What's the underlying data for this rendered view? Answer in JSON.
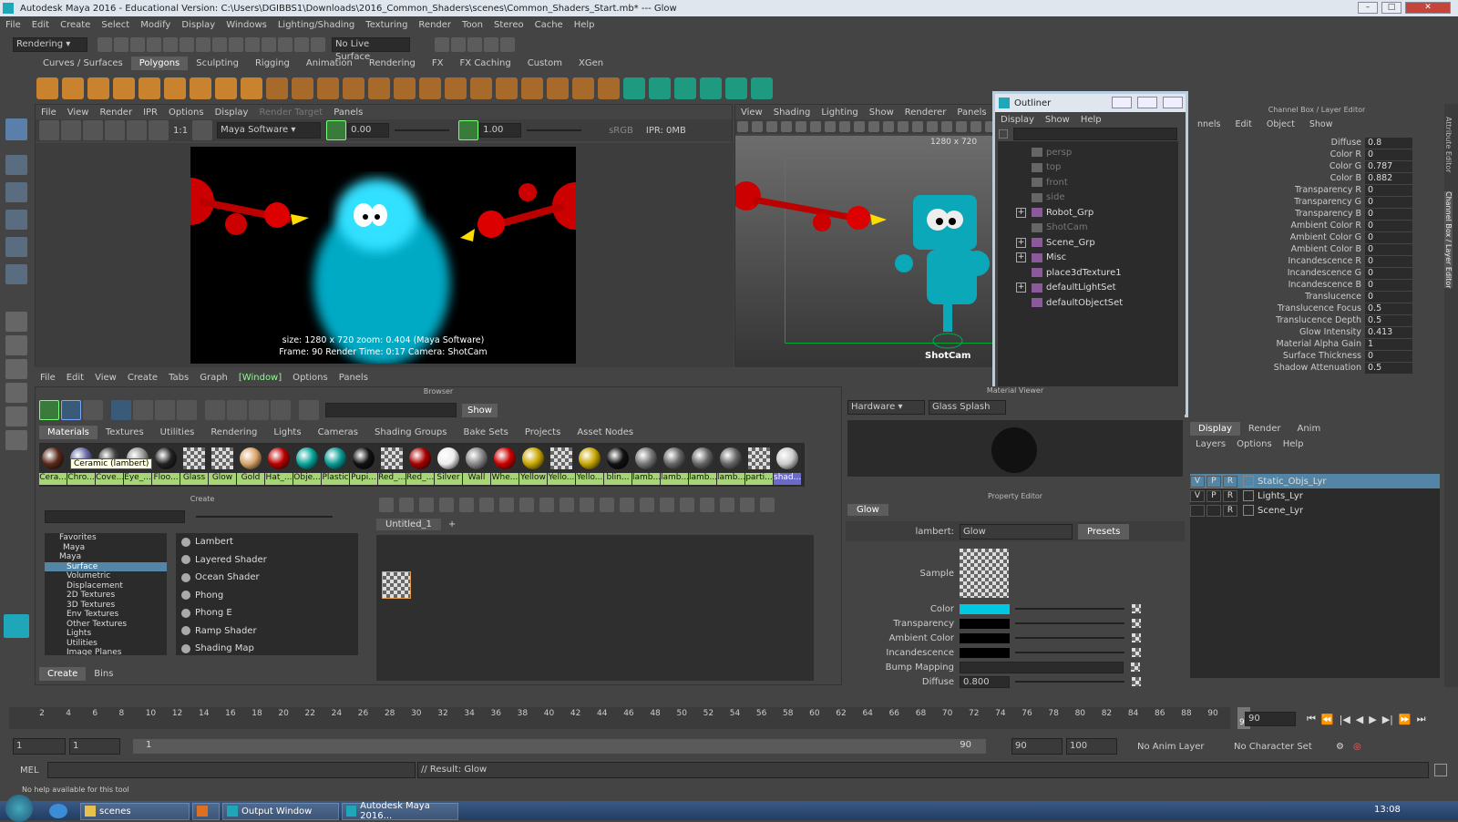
{
  "title": "Autodesk Maya 2016 - Educational Version: C:\\Users\\DGIBBS1\\Downloads\\2016_Common_Shaders\\scenes\\Common_Shaders_Start.mb*  ---  Glow",
  "menu": [
    "File",
    "Edit",
    "Create",
    "Select",
    "Modify",
    "Display",
    "Windows",
    "Lighting/Shading",
    "Texturing",
    "Render",
    "Toon",
    "Stereo",
    "Cache",
    "Help"
  ],
  "menuset": "Rendering",
  "live_surface": "No Live Surface",
  "shelf_tabs": [
    "Curves / Surfaces",
    "Polygons",
    "Sculpting",
    "Rigging",
    "Animation",
    "Rendering",
    "FX",
    "FX Caching",
    "Custom",
    "XGen"
  ],
  "render_view": {
    "menu": [
      "File",
      "View",
      "Render",
      "IPR",
      "Options",
      "Display",
      "Render Target",
      "Panels"
    ],
    "renderer": "Maya Software",
    "exposure": "0.00",
    "gamma": "1.00",
    "srgb": "sRGB",
    "ipr": "IPR: 0MB",
    "ratio": "1:1",
    "info1": "size: 1280 x 720  zoom: 0.404       (Maya Software)",
    "info2": "Frame: 90      Render Time: 0:17        Camera: ShotCam"
  },
  "viewport": {
    "menu": [
      "View",
      "Shading",
      "Lighting",
      "Show",
      "Renderer",
      "Panels"
    ],
    "res": "1280 x 720",
    "camera": "ShotCam"
  },
  "outliner": {
    "title": "Outliner",
    "menu": [
      "Display",
      "Show",
      "Help"
    ],
    "items": [
      {
        "label": "persp",
        "dim": true,
        "plus": false
      },
      {
        "label": "top",
        "dim": true,
        "plus": false
      },
      {
        "label": "front",
        "dim": true,
        "plus": false
      },
      {
        "label": "side",
        "dim": true,
        "plus": false
      },
      {
        "label": "Robot_Grp",
        "dim": false,
        "plus": true
      },
      {
        "label": "ShotCam",
        "dim": true,
        "plus": false
      },
      {
        "label": "Scene_Grp",
        "dim": false,
        "plus": true
      },
      {
        "label": "Misc",
        "dim": false,
        "plus": true
      },
      {
        "label": "place3dTexture1",
        "dim": false,
        "plus": false
      },
      {
        "label": "defaultLightSet",
        "dim": false,
        "plus": true
      },
      {
        "label": "defaultObjectSet",
        "dim": false,
        "plus": false
      }
    ]
  },
  "channel_box": {
    "title": "Channel Box / Layer Editor",
    "menu": [
      "nnels",
      "Edit",
      "Object",
      "Show"
    ],
    "attrs": [
      {
        "n": "Diffuse",
        "v": "0.8"
      },
      {
        "n": "Color R",
        "v": "0"
      },
      {
        "n": "Color G",
        "v": "0.787"
      },
      {
        "n": "Color B",
        "v": "0.882"
      },
      {
        "n": "Transparency R",
        "v": "0"
      },
      {
        "n": "Transparency G",
        "v": "0"
      },
      {
        "n": "Transparency B",
        "v": "0"
      },
      {
        "n": "Ambient Color R",
        "v": "0"
      },
      {
        "n": "Ambient Color G",
        "v": "0"
      },
      {
        "n": "Ambient Color B",
        "v": "0"
      },
      {
        "n": "Incandescence R",
        "v": "0"
      },
      {
        "n": "Incandescence G",
        "v": "0"
      },
      {
        "n": "Incandescence B",
        "v": "0"
      },
      {
        "n": "Translucence",
        "v": "0"
      },
      {
        "n": "Translucence Focus",
        "v": "0.5"
      },
      {
        "n": "Translucence Depth",
        "v": "0.5"
      },
      {
        "n": "Glow Intensity",
        "v": "0.413"
      },
      {
        "n": "Material Alpha Gain",
        "v": "1"
      },
      {
        "n": "Surface Thickness",
        "v": "0"
      },
      {
        "n": "Shadow Attenuation",
        "v": "0.5"
      }
    ]
  },
  "side_tabs": [
    "Attribute Editor",
    "Channel Box / Layer Editor"
  ],
  "hypershade": {
    "menu": [
      "File",
      "Edit",
      "View",
      "Create",
      "Tabs",
      "Graph",
      "[Window]",
      "Options",
      "Panels"
    ],
    "browser_title": "Browser",
    "show": "Show",
    "browser_tabs": [
      "Materials",
      "Textures",
      "Utilities",
      "Rendering",
      "Lights",
      "Cameras",
      "Shading Groups",
      "Bake Sets",
      "Projects",
      "Asset Nodes"
    ],
    "tooltip": "Ceramic (lambert)",
    "swatches": [
      {
        "l": "Cera...",
        "c": "#5a2a1a"
      },
      {
        "l": "Chro...",
        "c": "#6a6aa8"
      },
      {
        "l": "Cove...",
        "c": "#444"
      },
      {
        "l": "Eye_...",
        "c": "#999"
      },
      {
        "l": "Floo...",
        "c": "#222"
      },
      {
        "l": "Glass",
        "c": "chk"
      },
      {
        "l": "Glow",
        "c": "chk"
      },
      {
        "l": "Gold",
        "c": "#d9a56a"
      },
      {
        "l": "Hat_...",
        "c": "#b00"
      },
      {
        "l": "Obje...",
        "c": "#0aa59a"
      },
      {
        "l": "Plastic",
        "c": "#0a9a95"
      },
      {
        "l": "Pupi...",
        "c": "#111"
      },
      {
        "l": "Red_...",
        "c": "chk"
      },
      {
        "l": "Red_...",
        "c": "#a00"
      },
      {
        "l": "Silver",
        "c": "#eee"
      },
      {
        "l": "Wall",
        "c": "#888"
      },
      {
        "l": "Whe...",
        "c": "#c00"
      },
      {
        "l": "Yellow",
        "c": "#c9a800"
      },
      {
        "l": "Yello...",
        "c": "chk"
      },
      {
        "l": "Yello...",
        "c": "#c9a800"
      },
      {
        "l": "blin...",
        "c": "#111"
      },
      {
        "l": "lamb...",
        "c": "#777"
      },
      {
        "l": "lamb...",
        "c": "#666"
      },
      {
        "l": "lamb...",
        "c": "#666"
      },
      {
        "l": "lamb...",
        "c": "#666"
      },
      {
        "l": "parti...",
        "c": "chk"
      },
      {
        "l": "shad...",
        "c": "#ccc"
      }
    ],
    "create_title": "Create",
    "tree": [
      {
        "l": "Favorites",
        "sel": false,
        "ind": 0
      },
      {
        "l": "Maya",
        "sel": false,
        "ind": 1
      },
      {
        "l": "Maya",
        "sel": false,
        "ind": 0
      },
      {
        "l": "Surface",
        "sel": true,
        "ind": 2
      },
      {
        "l": "Volumetric",
        "sel": false,
        "ind": 2
      },
      {
        "l": "Displacement",
        "sel": false,
        "ind": 2
      },
      {
        "l": "2D Textures",
        "sel": false,
        "ind": 2
      },
      {
        "l": "3D Textures",
        "sel": false,
        "ind": 2
      },
      {
        "l": "Env Textures",
        "sel": false,
        "ind": 2
      },
      {
        "l": "Other Textures",
        "sel": false,
        "ind": 2
      },
      {
        "l": "Lights",
        "sel": false,
        "ind": 2
      },
      {
        "l": "Utilities",
        "sel": false,
        "ind": 2
      },
      {
        "l": "Image Planes",
        "sel": false,
        "ind": 2
      }
    ],
    "create_items": [
      "Lambert",
      "Layered Shader",
      "Ocean Shader",
      "Phong",
      "Phong E",
      "Ramp Shader",
      "Shading Map"
    ],
    "bottom_tabs": [
      "Create",
      "Bins"
    ],
    "graph_tab": "Untitled_1",
    "graph_plus": "+"
  },
  "material_viewer": {
    "title": "Material Viewer",
    "renderer": "Hardware",
    "env": "Glass Splash"
  },
  "property_editor": {
    "title": "Property Editor",
    "tab": "Glow",
    "type_label": "lambert:",
    "name": "Glow",
    "presets": "Presets",
    "sample": "Sample",
    "rows": [
      "Color",
      "Transparency",
      "Ambient Color",
      "Incandescence",
      "Bump Mapping",
      "Diffuse"
    ],
    "diffuse_val": "0.800"
  },
  "layers": {
    "tabs": [
      "Display",
      "Render",
      "Anim"
    ],
    "menu": [
      "Layers",
      "Options",
      "Help"
    ],
    "rows": [
      {
        "v": "V",
        "p": "P",
        "r": "R",
        "name": "Static_Objs_Lyr",
        "sel": true
      },
      {
        "v": "V",
        "p": "P",
        "r": "R",
        "name": "Lights_Lyr",
        "sel": false
      },
      {
        "v": "",
        "p": "",
        "r": "R",
        "name": "Scene_Lyr",
        "sel": false
      }
    ]
  },
  "timeline": {
    "ticks": [
      "2",
      "4",
      "6",
      "8",
      "10",
      "12",
      "14",
      "16",
      "18",
      "20",
      "22",
      "24",
      "26",
      "28",
      "30",
      "32",
      "34",
      "36",
      "38",
      "40",
      "42",
      "44",
      "46",
      "48",
      "50",
      "52",
      "54",
      "56",
      "58",
      "60",
      "62",
      "64",
      "66",
      "68",
      "70",
      "72",
      "74",
      "76",
      "78",
      "80",
      "82",
      "84",
      "86",
      "88",
      "90"
    ],
    "current": "90",
    "field": "90",
    "current_progress": 1.0
  },
  "range": {
    "start": "1",
    "start2": "1",
    "bar_start": "1",
    "bar_end": "90",
    "end": "90",
    "end2": "100",
    "anim_layer": "No Anim Layer",
    "char_set": "No Character Set"
  },
  "command": {
    "lang": "MEL",
    "result": "// Result: Glow"
  },
  "help_line": "No help available for this tool",
  "taskbar": {
    "items": [
      "scenes",
      "",
      "Output Window",
      "Autodesk Maya 2016..."
    ],
    "clock": "13:08"
  }
}
